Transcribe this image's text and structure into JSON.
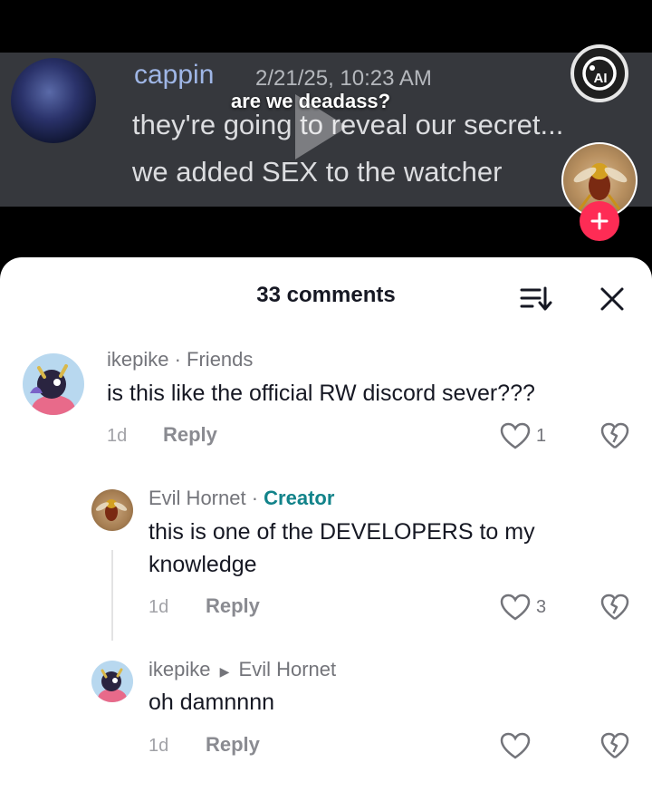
{
  "video": {
    "caption": "are we deadass?",
    "discord_message": {
      "username": "cappin",
      "timestamp": "2/21/25, 10:23 AM",
      "line1": "they're going to reveal our secret...",
      "line2": "we added SEX to the watcher"
    }
  },
  "comments_panel": {
    "title": "33 comments",
    "comments": [
      {
        "author": "ikepike",
        "tag": "Friends",
        "text": "is this like the official RW discord sever???",
        "time": "1d",
        "reply_label": "Reply",
        "likes": "1"
      }
    ],
    "replies": [
      {
        "author": "Evil Hornet",
        "tag": "Creator",
        "text": "this is one of the DEVELOPERS to my knowledge",
        "time": "1d",
        "reply_label": "Reply",
        "likes": "3"
      },
      {
        "author": "ikepike",
        "reply_to": "Evil Hornet",
        "text": "oh damnnnn",
        "time": "1d",
        "reply_label": "Reply"
      }
    ]
  },
  "colors": {
    "discord_bg": "#36383d",
    "discord_username": "#9fb6e6",
    "follow_button": "#fe2c55",
    "creator_tag": "#12838a"
  }
}
